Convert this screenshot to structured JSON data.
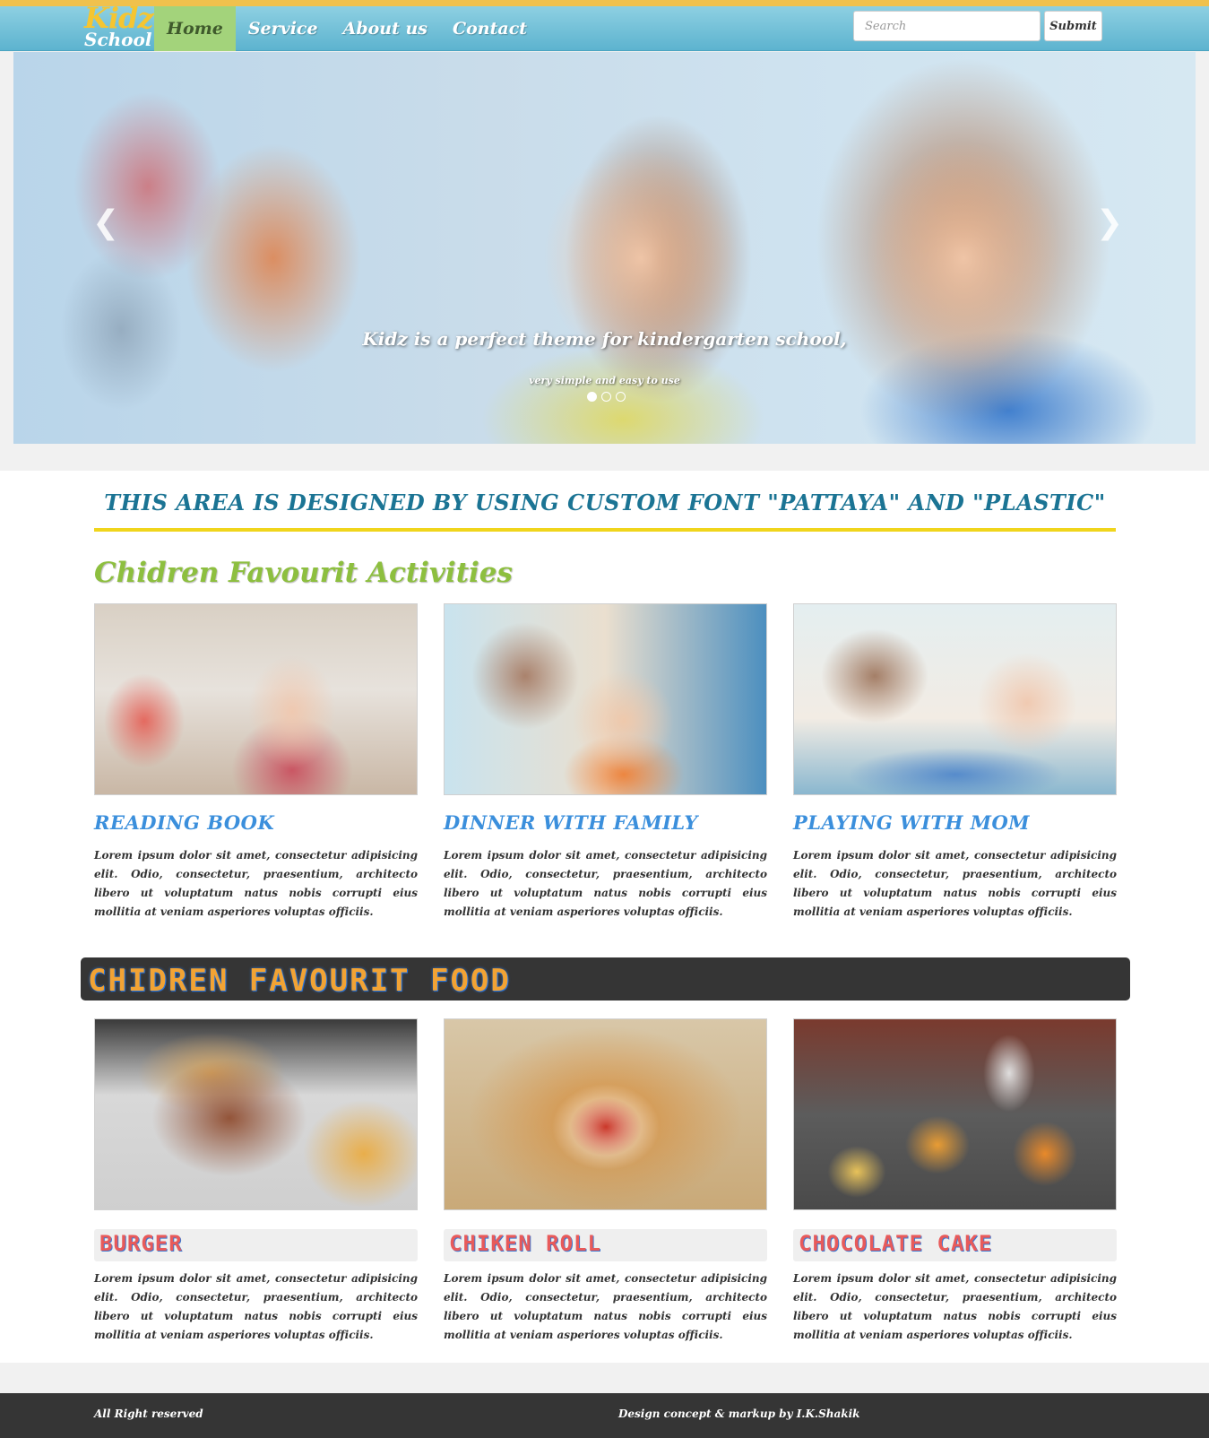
{
  "header": {
    "brand_top": "Kidz",
    "brand_bottom": "School",
    "nav": [
      {
        "label": "Home"
      },
      {
        "label": "Service"
      },
      {
        "label": "About us"
      },
      {
        "label": "Contact"
      }
    ],
    "search_placeholder": "Search",
    "submit_label": "Submit"
  },
  "carousel": {
    "caption": "Kidz is a perfect theme for kindergarten school,",
    "subcaption": "very simple and easy to use",
    "slide_count": 3,
    "active_slide": 1,
    "prev_icon": "chevron-left-icon",
    "next_icon": "chevron-right-icon"
  },
  "custom_font_heading": "THIS AREA IS DESIGNED BY USING CUSTOM FONT \"PATTAYA\" AND \"PLASTIC\"",
  "activities": {
    "title": "Chidren Favourit Activities",
    "items": [
      {
        "title": "READING BOOK",
        "text": "Lorem ipsum dolor sit amet, consectetur adipisicing elit. Odio, consectetur, praesentium, architecto libero ut voluptatum natus nobis corrupti eius mollitia at veniam asperiores voluptas officiis."
      },
      {
        "title": "DINNER WITH FAMILY",
        "text": "Lorem ipsum dolor sit amet, consectetur adipisicing elit. Odio, consectetur, praesentium, architecto libero ut voluptatum natus nobis corrupti eius mollitia at veniam asperiores voluptas officiis."
      },
      {
        "title": "PLAYING WITH MOM",
        "text": "Lorem ipsum dolor sit amet, consectetur adipisicing elit. Odio, consectetur, praesentium, architecto libero ut voluptatum natus nobis corrupti eius mollitia at veniam asperiores voluptas officiis."
      }
    ]
  },
  "food": {
    "title": "CHIDREN FAVOURIT FOOD",
    "items": [
      {
        "title": "BURGER",
        "text": "Lorem ipsum dolor sit amet, consectetur adipisicing elit. Odio, consectetur, praesentium, architecto libero ut voluptatum natus nobis corrupti eius mollitia at veniam asperiores voluptas officiis."
      },
      {
        "title": "CHIKEN ROLL",
        "text": "Lorem ipsum dolor sit amet, consectetur adipisicing elit. Odio, consectetur, praesentium, architecto libero ut voluptatum natus nobis corrupti eius mollitia at veniam asperiores voluptas officiis."
      },
      {
        "title": "CHOCOLATE CAKE",
        "text": "Lorem ipsum dolor sit amet, consectetur adipisicing elit. Odio, consectetur, praesentium, architecto libero ut voluptatum natus nobis corrupti eius mollitia at veniam asperiores voluptas officiis."
      }
    ]
  },
  "footer": {
    "left": "All Right reserved",
    "right": "Design concept & markup by I.K.Shakik"
  },
  "colors": {
    "nav_bar": "#5db3cf",
    "nav_active": "#a3d37b",
    "top_accent": "#f0c14d",
    "heading_blue": "#1b7494",
    "underline_yellow": "#f0d51c",
    "activities_green": "#8dbf3f",
    "item_title_blue": "#3b8fdc",
    "dark_bar": "#353535"
  }
}
